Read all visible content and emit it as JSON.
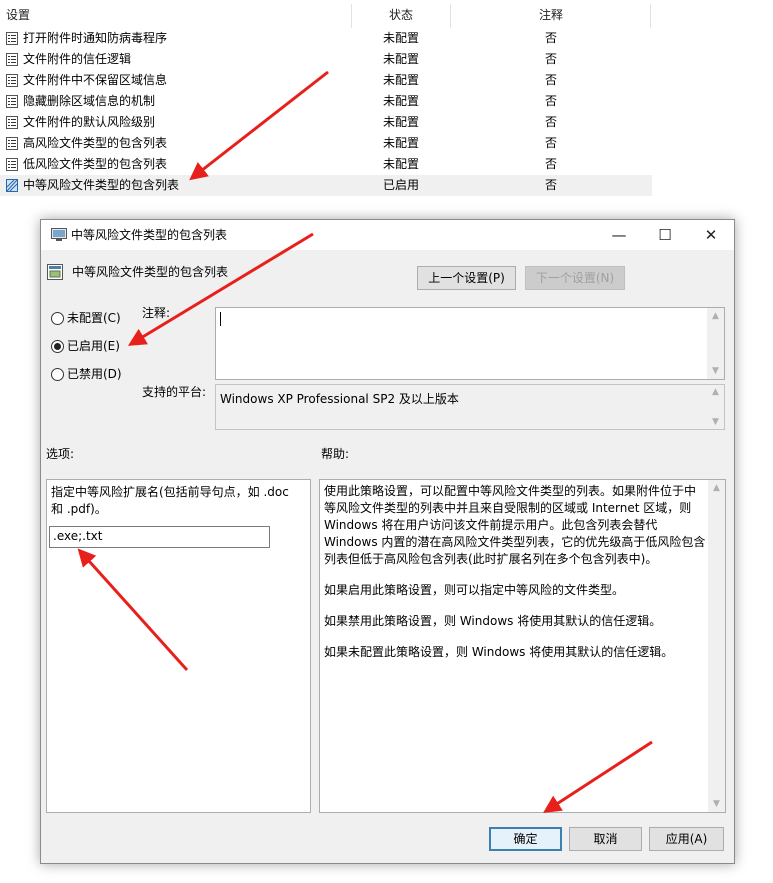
{
  "list": {
    "columns": {
      "setting": "设置",
      "state": "状态",
      "comment": "注释"
    },
    "rows": [
      {
        "name": "打开附件时通知防病毒程序",
        "state": "未配置",
        "comment": "否",
        "icon": "policy-icon"
      },
      {
        "name": "文件附件的信任逻辑",
        "state": "未配置",
        "comment": "否",
        "icon": "policy-icon"
      },
      {
        "name": "文件附件中不保留区域信息",
        "state": "未配置",
        "comment": "否",
        "icon": "policy-icon"
      },
      {
        "name": "隐藏删除区域信息的机制",
        "state": "未配置",
        "comment": "否",
        "icon": "policy-icon"
      },
      {
        "name": "文件附件的默认风险级别",
        "state": "未配置",
        "comment": "否",
        "icon": "policy-icon"
      },
      {
        "name": "高风险文件类型的包含列表",
        "state": "未配置",
        "comment": "否",
        "icon": "policy-icon"
      },
      {
        "name": "低风险文件类型的包含列表",
        "state": "未配置",
        "comment": "否",
        "icon": "policy-icon"
      },
      {
        "name": "中等风险文件类型的包含列表",
        "state": "已启用",
        "comment": "否",
        "icon": "policy-selected-icon",
        "selected": true
      }
    ]
  },
  "dialog": {
    "title": "中等风险文件类型的包含列表",
    "window_buttons": {
      "minimize": "—",
      "maximize": "☐",
      "close": "✕"
    },
    "policy_name": "中等风险文件类型的包含列表",
    "prev_button": "上一个设置(P)",
    "next_button": "下一个设置(N)",
    "radios": [
      {
        "label": "未配置(C)",
        "checked": false
      },
      {
        "label": "已启用(E)",
        "checked": true
      },
      {
        "label": "已禁用(D)",
        "checked": false
      }
    ],
    "comment_label": "注释:",
    "comment_value": "",
    "platform_label": "支持的平台:",
    "platform_value": "Windows XP Professional SP2 及以上版本",
    "options_label": "选项:",
    "help_label": "帮助:",
    "option_description": "指定中等风险扩展名(包括前导句点，如 .doc 和 .pdf)。",
    "option_value": ".exe;.txt",
    "help_paragraphs": [
      "使用此策略设置，可以配置中等风险文件类型的列表。如果附件位于中等风险文件类型的列表中并且来自受限制的区域或 Internet 区域，则 Windows 将在用户访问该文件前提示用户。此包含列表会替代 Windows 内置的潜在高风险文件类型列表，它的优先级高于低风险包含列表但低于高风险包含列表(此时扩展名列在多个包含列表中)。",
      "如果启用此策略设置，则可以指定中等风险的文件类型。",
      "如果禁用此策略设置，则 Windows 将使用其默认的信任逻辑。",
      "如果未配置此策略设置，则 Windows 将使用其默认的信任逻辑。"
    ],
    "ok_button": "确定",
    "cancel_button": "取消",
    "apply_button": "应用(A)"
  },
  "colors": {
    "annotation_arrow": "#e8201c",
    "default_button_border": "#3c7fb1"
  }
}
